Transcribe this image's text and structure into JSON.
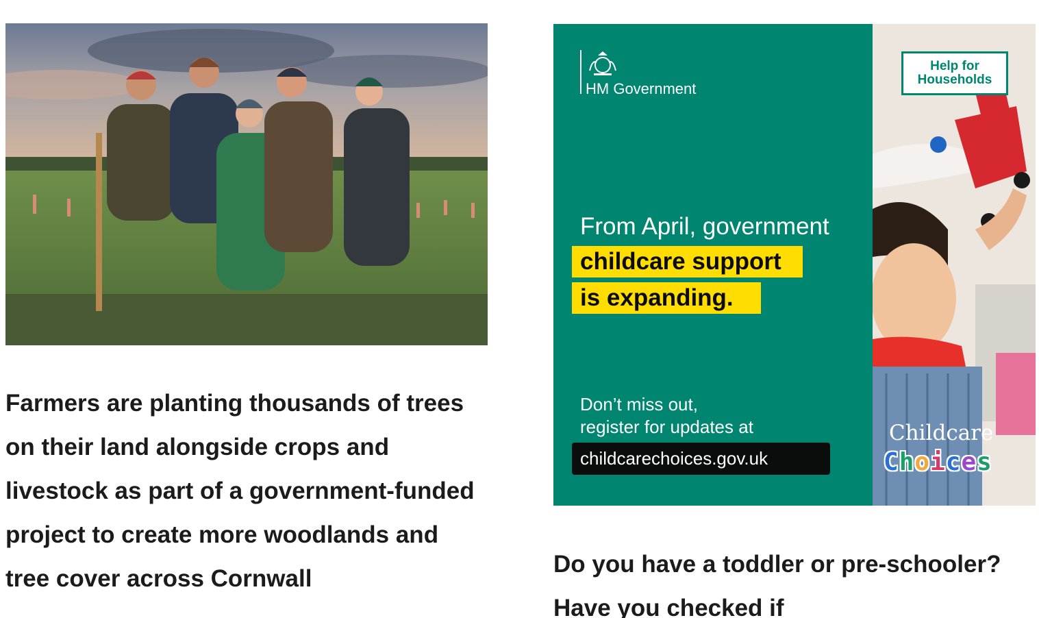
{
  "left_article": {
    "image_alt": "Farmers and a child standing in a field with tree saplings",
    "headline": "Farmers are planting thousands of trees on their land alongside crops and livestock as part of a government-funded project to create more woodlands and tree cover across Cornwall"
  },
  "right_article": {
    "ad": {
      "org": "HM Government",
      "badge_line1": "Help for",
      "badge_line2": "Households",
      "line1": "From April, government",
      "highlight1": "childcare support",
      "highlight2": "is expanding.",
      "cta_line1": "Don’t miss out,",
      "cta_line2": "register for updates at",
      "url": "childcarechoices.gov.uk",
      "brand_line1": "Childcare",
      "brand_line2": "Choices",
      "colors": {
        "ad_green": "#008670",
        "highlight_yellow": "#ffdd00",
        "pill_black": "#0b0c0c"
      }
    },
    "headline": "Do you have a toddler or pre-schooler? Have you checked if"
  }
}
